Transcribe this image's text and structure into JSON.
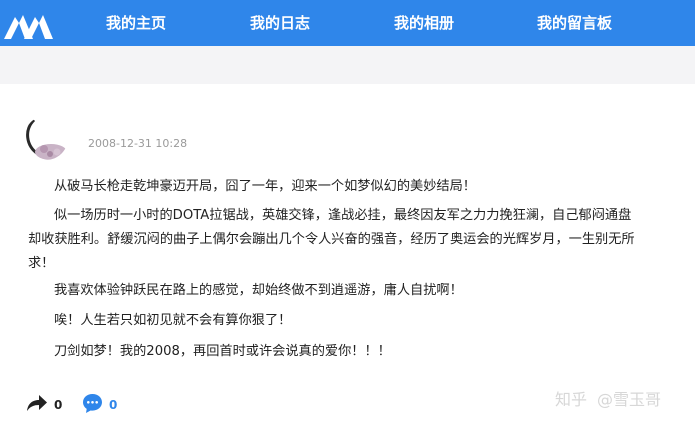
{
  "nav": {
    "items": [
      {
        "label": "我的主页"
      },
      {
        "label": "我的日志"
      },
      {
        "label": "我的相册"
      },
      {
        "label": "我的留言板"
      }
    ]
  },
  "post": {
    "date": "2008-12-31 10:28",
    "paragraphs": [
      [
        "从破马长枪走乾坤豪迈开局，囧了一年，迎来一个如梦似幻的美妙结局！"
      ],
      [
        "似一场历时一小时的DOTA拉锯战，英雄交锋，逢战必挂，最终因友军之力力挽狂澜，自己郁闷通盘",
        "却收获胜利。舒缓沉闷的曲子上偶尔会蹦出几个令人兴奋的强音，经历了奥运会的光辉岁月，一生别无所",
        "求！"
      ],
      [
        "我喜欢体验钟跃民在路上的感觉，却始终做不到逍遥游，庸人自扰啊！"
      ],
      [
        "唉！人生若只如初见就不会有算你狠了！"
      ],
      [
        "刀剑如梦！我的2008，再回首时或许会说真的爱你！！！"
      ]
    ]
  },
  "actions": {
    "share_count": "0",
    "comment_count": "0"
  },
  "watermark": {
    "site": "知乎",
    "author": "@雪玉哥"
  },
  "colors": {
    "nav_bg": "#2f86ea",
    "comment_accent": "#2f86ea",
    "band_bg": "#f4f4f6"
  }
}
